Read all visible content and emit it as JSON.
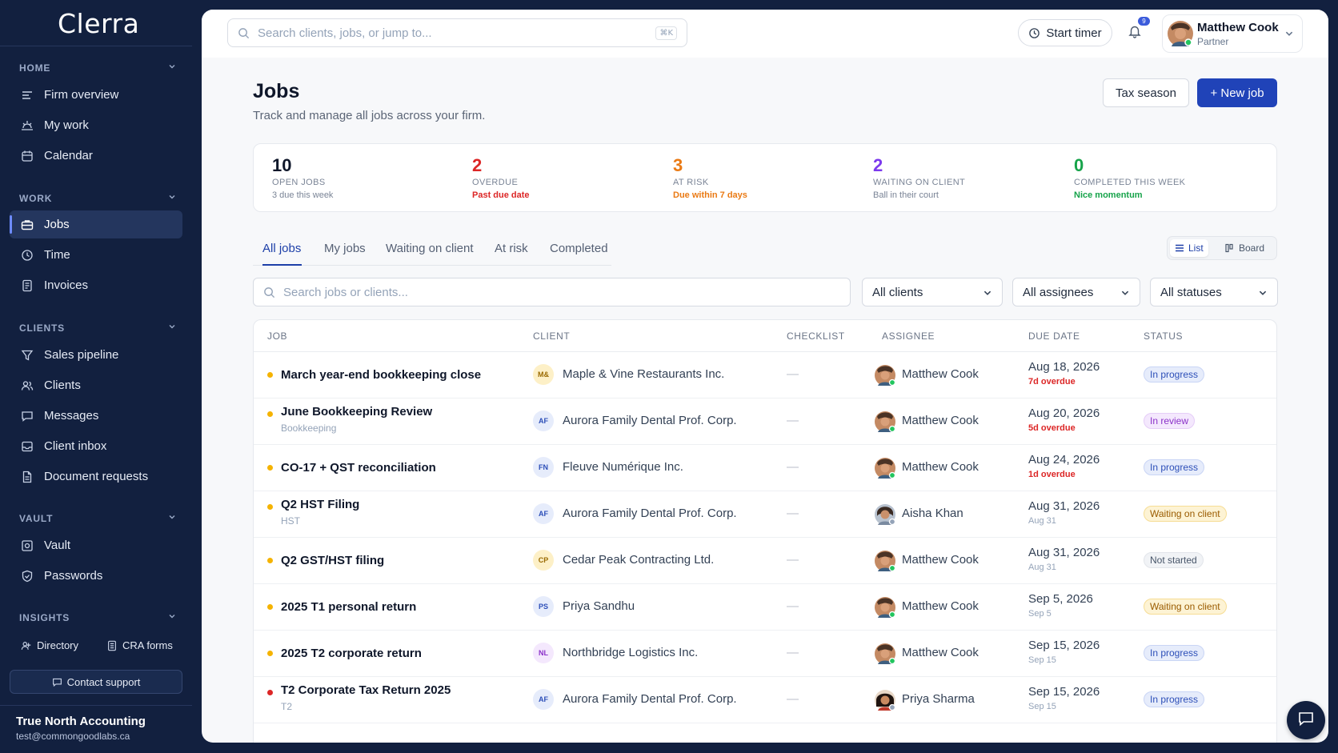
{
  "app": {
    "name": "Clerra"
  },
  "sidebar": {
    "sections": [
      {
        "label": "HOME",
        "items": [
          {
            "label": "Firm overview",
            "icon": "lines-icon"
          },
          {
            "label": "My work",
            "icon": "sunrise-icon"
          },
          {
            "label": "Calendar",
            "icon": "calendar-icon"
          }
        ]
      },
      {
        "label": "WORK",
        "items": [
          {
            "label": "Jobs",
            "icon": "briefcase-icon"
          },
          {
            "label": "Time",
            "icon": "clock-icon"
          },
          {
            "label": "Invoices",
            "icon": "receipt-icon"
          }
        ]
      },
      {
        "label": "CLIENTS",
        "items": [
          {
            "label": "Sales pipeline",
            "icon": "funnel-icon"
          },
          {
            "label": "Clients",
            "icon": "users-icon"
          },
          {
            "label": "Messages",
            "icon": "message-icon"
          },
          {
            "label": "Client inbox",
            "icon": "inbox-icon"
          },
          {
            "label": "Document requests",
            "icon": "document-icon"
          }
        ]
      },
      {
        "label": "VAULT",
        "items": [
          {
            "label": "Vault",
            "icon": "safe-icon"
          },
          {
            "label": "Passwords",
            "icon": "shield-icon"
          }
        ]
      },
      {
        "label": "INSIGHTS",
        "items": []
      }
    ],
    "active": "Jobs",
    "mini": [
      {
        "label": "Directory",
        "icon": "directory-icon"
      },
      {
        "label": "CRA forms",
        "icon": "form-icon"
      }
    ],
    "support_label": "Contact support",
    "org_name": "True North Accounting",
    "org_email": "test@commongoodlabs.ca"
  },
  "topbar": {
    "search_placeholder": "Search clients, jobs, or jump to...",
    "shortcut": "⌘K",
    "timer_label": "Start timer",
    "notifications": "9",
    "user": {
      "name": "Matthew Cook",
      "role": "Partner"
    }
  },
  "page": {
    "title": "Jobs",
    "subtitle": "Track and manage all jobs across your firm.",
    "tax_button": "Tax season",
    "new_button": "+ New job"
  },
  "stats": [
    {
      "value": "10",
      "label": "OPEN JOBS",
      "sub": "3 due this week",
      "color": "#0f172a",
      "sub_color": "#7a8496"
    },
    {
      "value": "2",
      "label": "OVERDUE",
      "sub": "Past due date",
      "color": "#dc2626",
      "sub_color": "#dc2626"
    },
    {
      "value": "3",
      "label": "AT RISK",
      "sub": "Due within 7 days",
      "color": "#ea7a14",
      "sub_color": "#ea7a14"
    },
    {
      "value": "2",
      "label": "WAITING ON CLIENT",
      "sub": "Ball in their court",
      "color": "#7c3aed",
      "sub_color": "#7a8496"
    },
    {
      "value": "0",
      "label": "COMPLETED THIS WEEK",
      "sub": "Nice momentum",
      "color": "#16a34a",
      "sub_color": "#16a34a"
    }
  ],
  "tabs": [
    "All jobs",
    "My jobs",
    "Waiting on client",
    "At risk",
    "Completed"
  ],
  "view_toggle": {
    "list": "List",
    "board": "Board"
  },
  "filters": {
    "search_placeholder": "Search jobs or clients...",
    "clients": "All clients",
    "assignees": "All assignees",
    "statuses": "All statuses"
  },
  "table": {
    "columns": [
      "JOB",
      "CLIENT",
      "CHECKLIST",
      "ASSIGNEE",
      "DUE DATE",
      "STATUS"
    ],
    "rows": [
      {
        "job": "March year-end bookkeeping close",
        "job_sub": "",
        "dot": "#f5b300",
        "client_initials": "M&",
        "client": "Maple & Vine Restaurants Inc.",
        "client_bg": "#fdf0c7",
        "client_fg": "#9a6a00",
        "checklist": "—",
        "assignee": "Matthew Cook",
        "due": "Aug 18, 2026",
        "due_sub": "7d overdue",
        "due_sub_color": "#dc2626",
        "status": "In progress",
        "status_bg": "#e6ecfb",
        "status_fg": "#2d4fb8",
        "status_border": "#c9d5f5"
      },
      {
        "job": "June Bookkeeping Review",
        "job_sub": "Bookkeeping",
        "dot": "#f5b300",
        "client_initials": "AF",
        "client": "Aurora Family Dental Prof. Corp.",
        "client_bg": "#e6ecfb",
        "client_fg": "#2d4fb8",
        "checklist": "—",
        "assignee": "Matthew Cook",
        "due": "Aug 20, 2026",
        "due_sub": "5d overdue",
        "due_sub_color": "#dc2626",
        "status": "In review",
        "status_bg": "#f4e8fd",
        "status_fg": "#8b32c9",
        "status_border": "#e5cdf8"
      },
      {
        "job": "CO-17 + QST reconciliation",
        "job_sub": "",
        "dot": "#f5b300",
        "client_initials": "FN",
        "client": "Fleuve Numérique Inc.",
        "client_bg": "#e6ecfb",
        "client_fg": "#2d4fb8",
        "checklist": "—",
        "assignee": "Matthew Cook",
        "due": "Aug 24, 2026",
        "due_sub": "1d overdue",
        "due_sub_color": "#dc2626",
        "status": "In progress",
        "status_bg": "#e6ecfb",
        "status_fg": "#2d4fb8",
        "status_border": "#c9d5f5"
      },
      {
        "job": "Q2 HST Filing",
        "job_sub": "HST",
        "dot": "#f5b300",
        "client_initials": "AF",
        "client": "Aurora Family Dental Prof. Corp.",
        "client_bg": "#e6ecfb",
        "client_fg": "#2d4fb8",
        "checklist": "—",
        "assignee": "Aisha Khan",
        "due": "Aug 31, 2026",
        "due_sub": "Aug 31",
        "due_sub_color": "#94a3b8",
        "status": "Waiting on client",
        "status_bg": "#fdf3d4",
        "status_fg": "#9a5b00",
        "status_border": "#f6dd95"
      },
      {
        "job": "Q2 GST/HST filing",
        "job_sub": "",
        "dot": "#f5b300",
        "client_initials": "CP",
        "client": "Cedar Peak Contracting Ltd.",
        "client_bg": "#fdf0c7",
        "client_fg": "#9a6a00",
        "checklist": "—",
        "assignee": "Matthew Cook",
        "due": "Aug 31, 2026",
        "due_sub": "Aug 31",
        "due_sub_color": "#94a3b8",
        "status": "Not started",
        "status_bg": "#f1f3f6",
        "status_fg": "#475569",
        "status_border": "#e2e5ea"
      },
      {
        "job": "2025 T1 personal return",
        "job_sub": "",
        "dot": "#f5b300",
        "client_initials": "PS",
        "client": "Priya Sandhu",
        "client_bg": "#e6ecfb",
        "client_fg": "#2d4fb8",
        "checklist": "—",
        "assignee": "Matthew Cook",
        "due": "Sep 5, 2026",
        "due_sub": "Sep 5",
        "due_sub_color": "#94a3b8",
        "status": "Waiting on client",
        "status_bg": "#fdf3d4",
        "status_fg": "#9a5b00",
        "status_border": "#f6dd95"
      },
      {
        "job": "2025 T2 corporate return",
        "job_sub": "",
        "dot": "#f5b300",
        "client_initials": "NL",
        "client": "Northbridge Logistics Inc.",
        "client_bg": "#f4e8fd",
        "client_fg": "#8b32c9",
        "checklist": "—",
        "assignee": "Matthew Cook",
        "due": "Sep 15, 2026",
        "due_sub": "Sep 15",
        "due_sub_color": "#94a3b8",
        "status": "In progress",
        "status_bg": "#e6ecfb",
        "status_fg": "#2d4fb8",
        "status_border": "#c9d5f5"
      },
      {
        "job": "T2 Corporate Tax Return 2025",
        "job_sub": "T2",
        "dot": "#dc2626",
        "client_initials": "AF",
        "client": "Aurora Family Dental Prof. Corp.",
        "client_bg": "#e6ecfb",
        "client_fg": "#2d4fb8",
        "checklist": "—",
        "assignee": "Priya Sharma",
        "due": "Sep 15, 2026",
        "due_sub": "Sep 15",
        "due_sub_color": "#94a3b8",
        "status": "In progress",
        "status_bg": "#e6ecfb",
        "status_fg": "#2d4fb8",
        "status_border": "#c9d5f5"
      }
    ]
  }
}
